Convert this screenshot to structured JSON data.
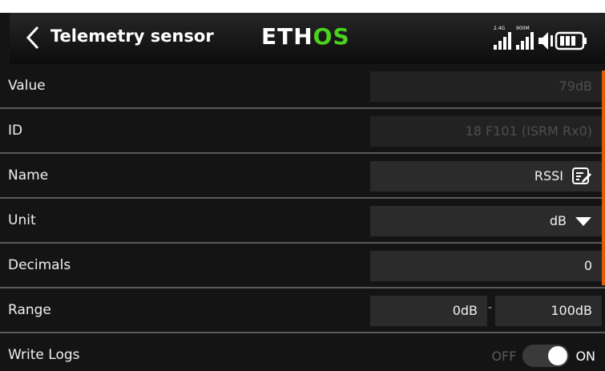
{
  "header": {
    "title": "Telemetry sensor",
    "logo_main": "ETH",
    "logo_accent": "OS",
    "accent_color": "#4bd21e",
    "status_icons": [
      "2.4G",
      "900M"
    ]
  },
  "fields": {
    "value": {
      "label": "Value",
      "value": "79dB"
    },
    "id": {
      "label": "ID",
      "value": "18 F101 (ISRM Rx0)"
    },
    "name": {
      "label": "Name",
      "value": "RSSI"
    },
    "unit": {
      "label": "Unit",
      "value": "dB"
    },
    "decimals": {
      "label": "Decimals",
      "value": "0"
    },
    "range": {
      "label": "Range",
      "min": "0dB",
      "separator": "-",
      "max": "100dB"
    },
    "write_logs": {
      "label": "Write Logs",
      "off_label": "OFF",
      "on_label": "ON",
      "state": "ON"
    }
  },
  "scrollbar_color": "#e05a10"
}
